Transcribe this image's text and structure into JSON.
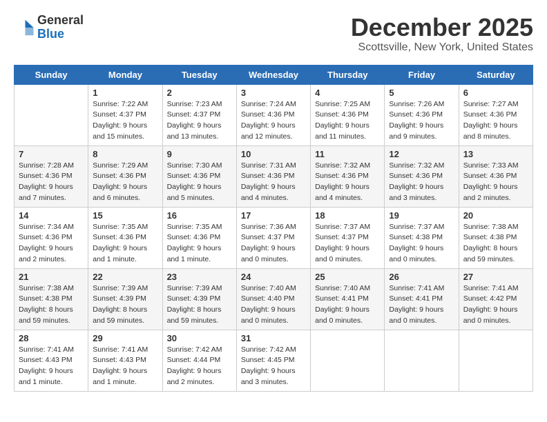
{
  "logo": {
    "general": "General",
    "blue": "Blue"
  },
  "header": {
    "month": "December 2025",
    "location": "Scottsville, New York, United States"
  },
  "weekdays": [
    "Sunday",
    "Monday",
    "Tuesday",
    "Wednesday",
    "Thursday",
    "Friday",
    "Saturday"
  ],
  "weeks": [
    [
      {
        "day": "",
        "sunrise": "",
        "sunset": "",
        "daylight": ""
      },
      {
        "day": "1",
        "sunrise": "Sunrise: 7:22 AM",
        "sunset": "Sunset: 4:37 PM",
        "daylight": "Daylight: 9 hours and 15 minutes."
      },
      {
        "day": "2",
        "sunrise": "Sunrise: 7:23 AM",
        "sunset": "Sunset: 4:37 PM",
        "daylight": "Daylight: 9 hours and 13 minutes."
      },
      {
        "day": "3",
        "sunrise": "Sunrise: 7:24 AM",
        "sunset": "Sunset: 4:36 PM",
        "daylight": "Daylight: 9 hours and 12 minutes."
      },
      {
        "day": "4",
        "sunrise": "Sunrise: 7:25 AM",
        "sunset": "Sunset: 4:36 PM",
        "daylight": "Daylight: 9 hours and 11 minutes."
      },
      {
        "day": "5",
        "sunrise": "Sunrise: 7:26 AM",
        "sunset": "Sunset: 4:36 PM",
        "daylight": "Daylight: 9 hours and 9 minutes."
      },
      {
        "day": "6",
        "sunrise": "Sunrise: 7:27 AM",
        "sunset": "Sunset: 4:36 PM",
        "daylight": "Daylight: 9 hours and 8 minutes."
      }
    ],
    [
      {
        "day": "7",
        "sunrise": "Sunrise: 7:28 AM",
        "sunset": "Sunset: 4:36 PM",
        "daylight": "Daylight: 9 hours and 7 minutes."
      },
      {
        "day": "8",
        "sunrise": "Sunrise: 7:29 AM",
        "sunset": "Sunset: 4:36 PM",
        "daylight": "Daylight: 9 hours and 6 minutes."
      },
      {
        "day": "9",
        "sunrise": "Sunrise: 7:30 AM",
        "sunset": "Sunset: 4:36 PM",
        "daylight": "Daylight: 9 hours and 5 minutes."
      },
      {
        "day": "10",
        "sunrise": "Sunrise: 7:31 AM",
        "sunset": "Sunset: 4:36 PM",
        "daylight": "Daylight: 9 hours and 4 minutes."
      },
      {
        "day": "11",
        "sunrise": "Sunrise: 7:32 AM",
        "sunset": "Sunset: 4:36 PM",
        "daylight": "Daylight: 9 hours and 4 minutes."
      },
      {
        "day": "12",
        "sunrise": "Sunrise: 7:32 AM",
        "sunset": "Sunset: 4:36 PM",
        "daylight": "Daylight: 9 hours and 3 minutes."
      },
      {
        "day": "13",
        "sunrise": "Sunrise: 7:33 AM",
        "sunset": "Sunset: 4:36 PM",
        "daylight": "Daylight: 9 hours and 2 minutes."
      }
    ],
    [
      {
        "day": "14",
        "sunrise": "Sunrise: 7:34 AM",
        "sunset": "Sunset: 4:36 PM",
        "daylight": "Daylight: 9 hours and 2 minutes."
      },
      {
        "day": "15",
        "sunrise": "Sunrise: 7:35 AM",
        "sunset": "Sunset: 4:36 PM",
        "daylight": "Daylight: 9 hours and 1 minute."
      },
      {
        "day": "16",
        "sunrise": "Sunrise: 7:35 AM",
        "sunset": "Sunset: 4:36 PM",
        "daylight": "Daylight: 9 hours and 1 minute."
      },
      {
        "day": "17",
        "sunrise": "Sunrise: 7:36 AM",
        "sunset": "Sunset: 4:37 PM",
        "daylight": "Daylight: 9 hours and 0 minutes."
      },
      {
        "day": "18",
        "sunrise": "Sunrise: 7:37 AM",
        "sunset": "Sunset: 4:37 PM",
        "daylight": "Daylight: 9 hours and 0 minutes."
      },
      {
        "day": "19",
        "sunrise": "Sunrise: 7:37 AM",
        "sunset": "Sunset: 4:38 PM",
        "daylight": "Daylight: 9 hours and 0 minutes."
      },
      {
        "day": "20",
        "sunrise": "Sunrise: 7:38 AM",
        "sunset": "Sunset: 4:38 PM",
        "daylight": "Daylight: 8 hours and 59 minutes."
      }
    ],
    [
      {
        "day": "21",
        "sunrise": "Sunrise: 7:38 AM",
        "sunset": "Sunset: 4:38 PM",
        "daylight": "Daylight: 8 hours and 59 minutes."
      },
      {
        "day": "22",
        "sunrise": "Sunrise: 7:39 AM",
        "sunset": "Sunset: 4:39 PM",
        "daylight": "Daylight: 8 hours and 59 minutes."
      },
      {
        "day": "23",
        "sunrise": "Sunrise: 7:39 AM",
        "sunset": "Sunset: 4:39 PM",
        "daylight": "Daylight: 8 hours and 59 minutes."
      },
      {
        "day": "24",
        "sunrise": "Sunrise: 7:40 AM",
        "sunset": "Sunset: 4:40 PM",
        "daylight": "Daylight: 9 hours and 0 minutes."
      },
      {
        "day": "25",
        "sunrise": "Sunrise: 7:40 AM",
        "sunset": "Sunset: 4:41 PM",
        "daylight": "Daylight: 9 hours and 0 minutes."
      },
      {
        "day": "26",
        "sunrise": "Sunrise: 7:41 AM",
        "sunset": "Sunset: 4:41 PM",
        "daylight": "Daylight: 9 hours and 0 minutes."
      },
      {
        "day": "27",
        "sunrise": "Sunrise: 7:41 AM",
        "sunset": "Sunset: 4:42 PM",
        "daylight": "Daylight: 9 hours and 0 minutes."
      }
    ],
    [
      {
        "day": "28",
        "sunrise": "Sunrise: 7:41 AM",
        "sunset": "Sunset: 4:43 PM",
        "daylight": "Daylight: 9 hours and 1 minute."
      },
      {
        "day": "29",
        "sunrise": "Sunrise: 7:41 AM",
        "sunset": "Sunset: 4:43 PM",
        "daylight": "Daylight: 9 hours and 1 minute."
      },
      {
        "day": "30",
        "sunrise": "Sunrise: 7:42 AM",
        "sunset": "Sunset: 4:44 PM",
        "daylight": "Daylight: 9 hours and 2 minutes."
      },
      {
        "day": "31",
        "sunrise": "Sunrise: 7:42 AM",
        "sunset": "Sunset: 4:45 PM",
        "daylight": "Daylight: 9 hours and 3 minutes."
      },
      {
        "day": "",
        "sunrise": "",
        "sunset": "",
        "daylight": ""
      },
      {
        "day": "",
        "sunrise": "",
        "sunset": "",
        "daylight": ""
      },
      {
        "day": "",
        "sunrise": "",
        "sunset": "",
        "daylight": ""
      }
    ]
  ]
}
